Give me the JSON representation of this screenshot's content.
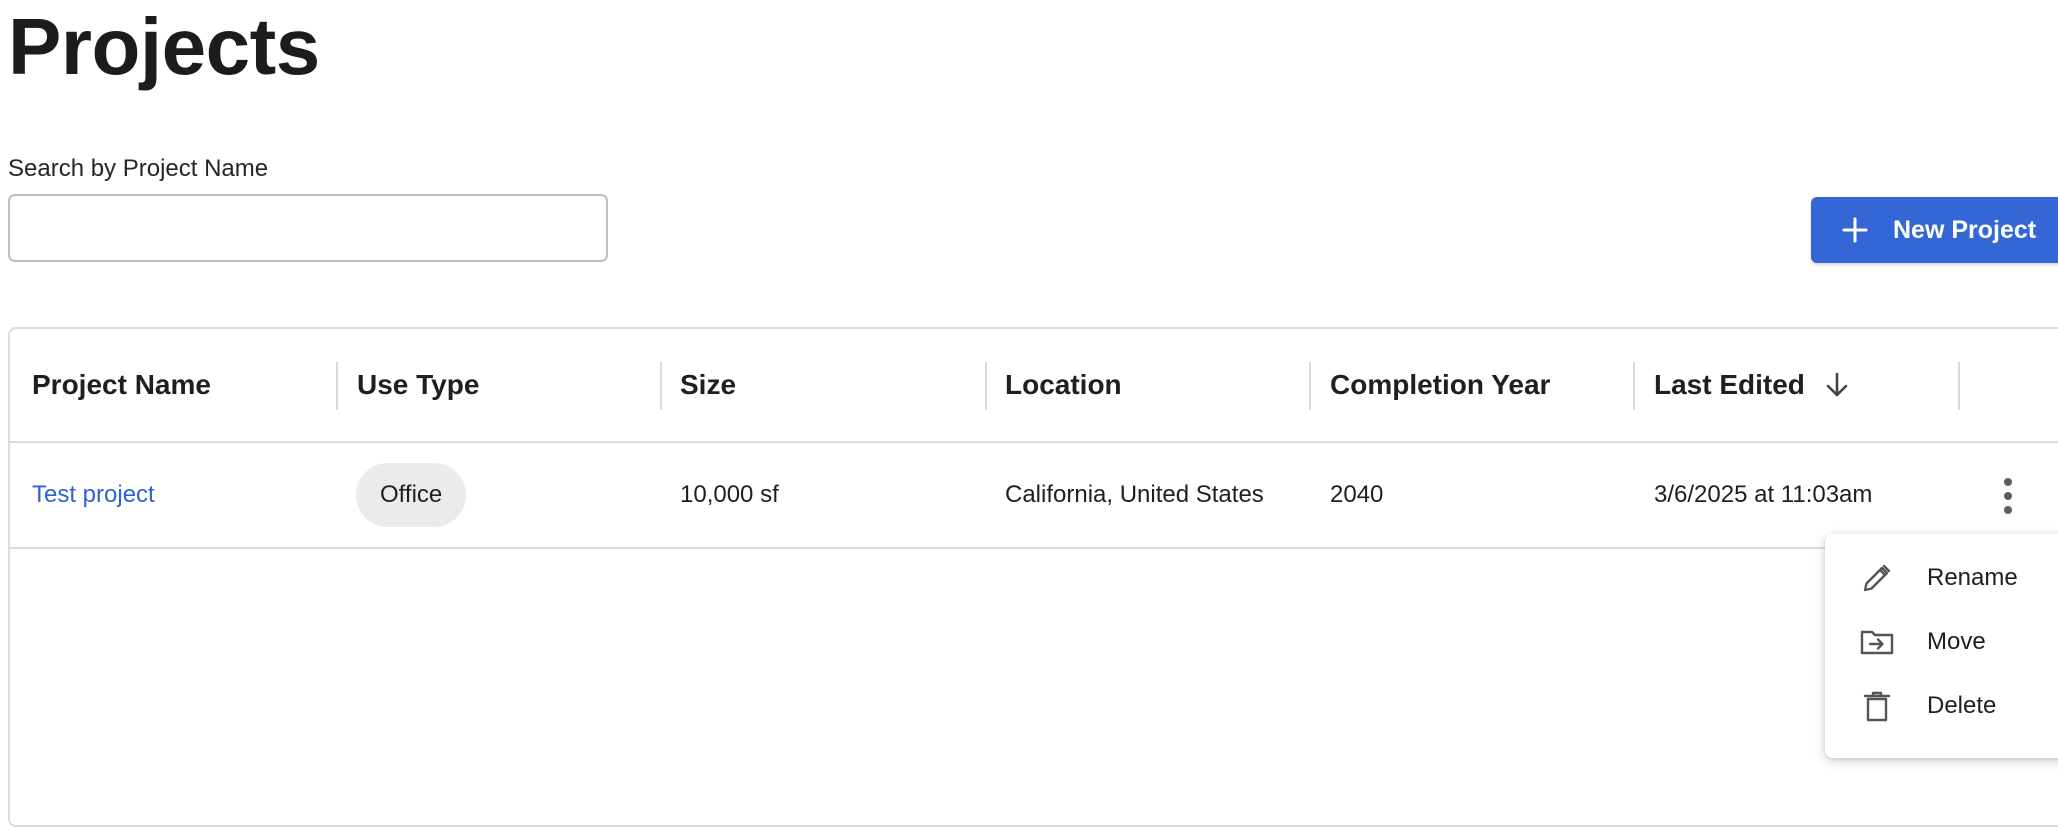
{
  "page": {
    "title": "Projects"
  },
  "search": {
    "label": "Search by Project Name",
    "value": "",
    "placeholder": ""
  },
  "toolbar": {
    "new_project_label": "New Project"
  },
  "table": {
    "columns": [
      {
        "key": "name",
        "label": "Project Name"
      },
      {
        "key": "use_type",
        "label": "Use Type"
      },
      {
        "key": "size",
        "label": "Size"
      },
      {
        "key": "location",
        "label": "Location"
      },
      {
        "key": "completion_year",
        "label": "Completion Year"
      },
      {
        "key": "last_edited",
        "label": "Last Edited",
        "sort": "descending"
      }
    ],
    "rows": [
      {
        "name": "Test project",
        "use_type": "Office",
        "size": "10,000 sf",
        "location": "California, United States",
        "completion_year": "2040",
        "last_edited": "3/6/2025 at 11:03am"
      }
    ]
  },
  "row_menu": {
    "items": [
      {
        "label": "Rename",
        "icon": "pencil-icon"
      },
      {
        "label": "Move",
        "icon": "folder-move-icon"
      },
      {
        "label": "Delete",
        "icon": "trash-icon"
      }
    ]
  },
  "colors": {
    "accent": "#3566d6",
    "link": "#2f62d4",
    "chip_bg": "#ebebeb",
    "border": "#dcdcdc"
  }
}
